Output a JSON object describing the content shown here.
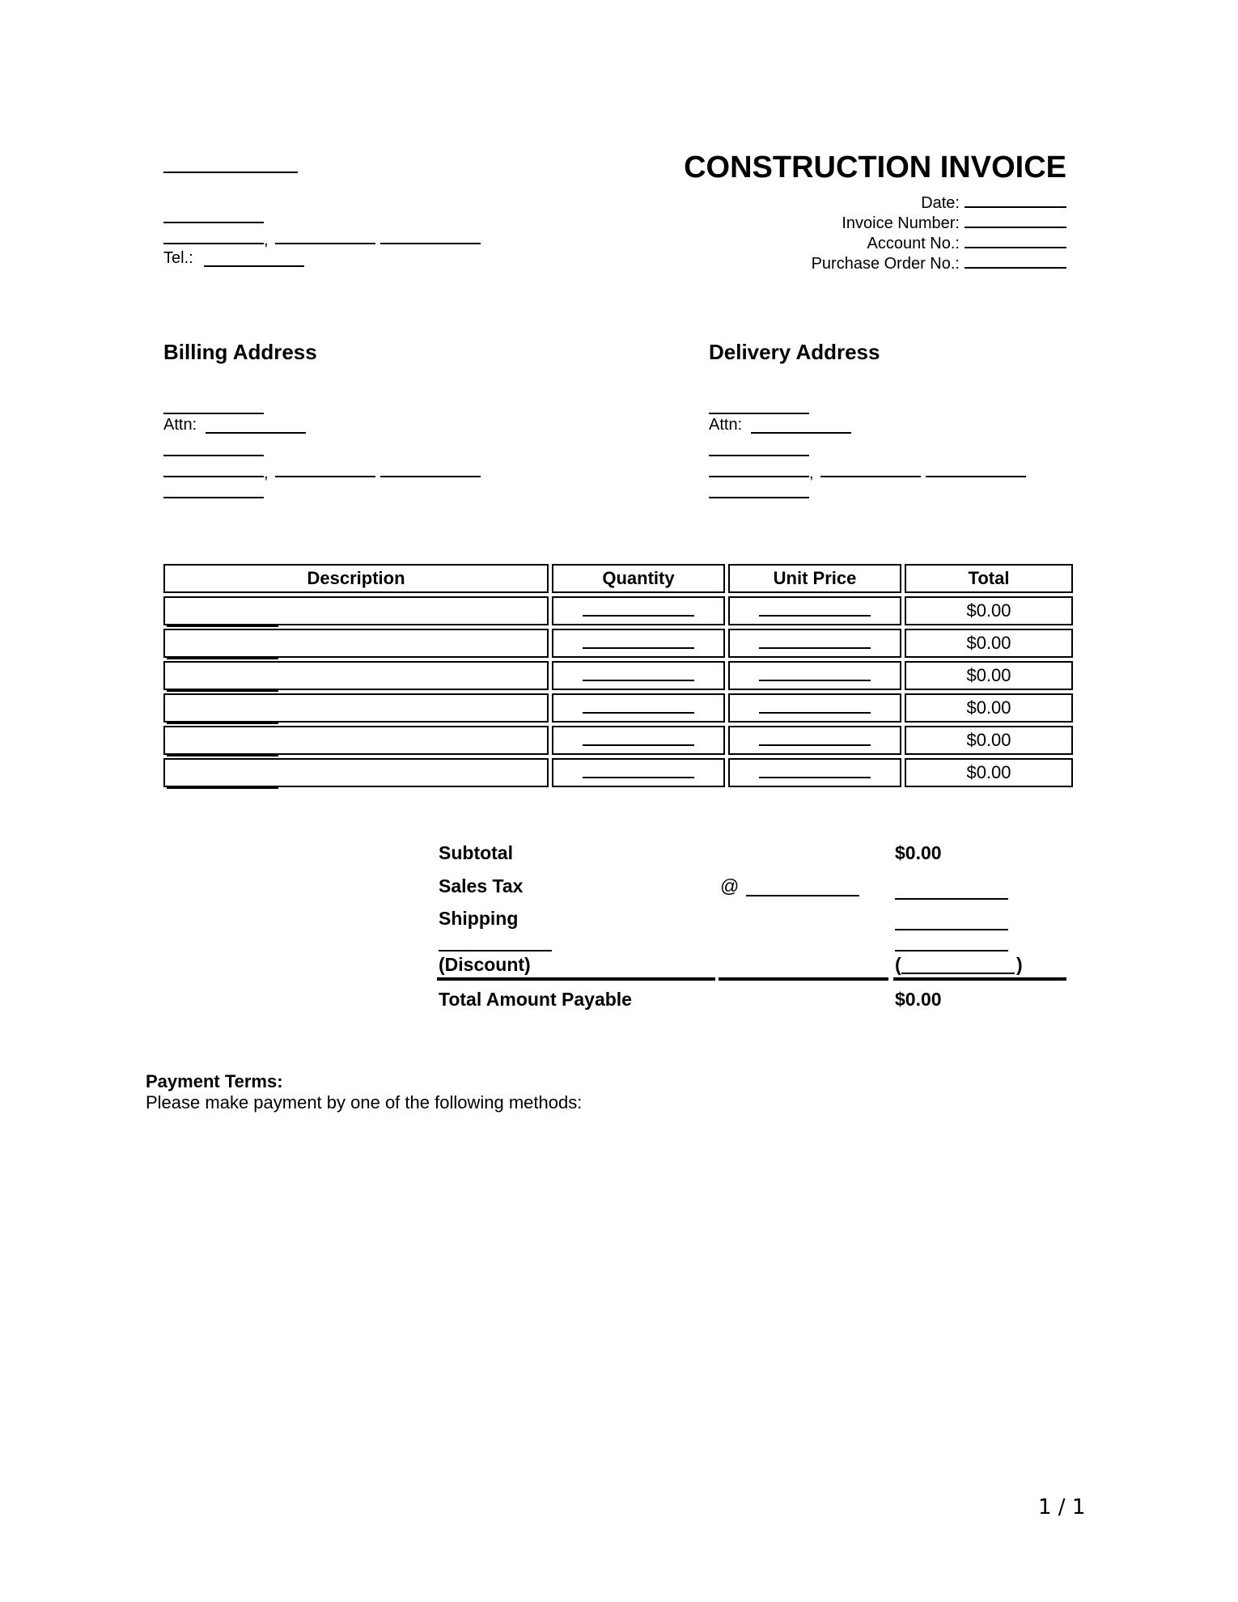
{
  "document": {
    "title": "CONSTRUCTION INVOICE",
    "page_indicator": "1 / 1"
  },
  "sender": {
    "tel_label": "Tel.:",
    "comma": ","
  },
  "meta": [
    {
      "label": "Date:",
      "value": ""
    },
    {
      "label": "Invoice Number:",
      "value": ""
    },
    {
      "label": "Account No.:",
      "value": ""
    },
    {
      "label": "Purchase Order No.:",
      "value": ""
    }
  ],
  "billing": {
    "heading": "Billing Address",
    "attn_label": "Attn:",
    "comma": ","
  },
  "delivery": {
    "heading": "Delivery Address",
    "attn_label": "Attn:",
    "comma": ","
  },
  "items_table": {
    "headers": [
      "Description",
      "Quantity",
      "Unit Price",
      "Total"
    ],
    "rows": [
      {
        "description": "",
        "quantity": "",
        "unit_price": "",
        "total": "$0.00"
      },
      {
        "description": "",
        "quantity": "",
        "unit_price": "",
        "total": "$0.00"
      },
      {
        "description": "",
        "quantity": "",
        "unit_price": "",
        "total": "$0.00"
      },
      {
        "description": "",
        "quantity": "",
        "unit_price": "",
        "total": "$0.00"
      },
      {
        "description": "",
        "quantity": "",
        "unit_price": "",
        "total": "$0.00"
      },
      {
        "description": "",
        "quantity": "",
        "unit_price": "",
        "total": "$0.00"
      }
    ]
  },
  "totals": {
    "subtotal_label": "Subtotal",
    "subtotal_value": "$0.00",
    "sales_tax_label": "Sales Tax",
    "sales_tax_at": "@",
    "shipping_label": "Shipping",
    "discount_label": "(Discount)",
    "discount_open": "(",
    "discount_close": ")",
    "total_label": "Total Amount Payable",
    "total_value": "$0.00"
  },
  "payment": {
    "heading": "Payment Terms:",
    "text": "Please make payment by one of the following methods:"
  }
}
